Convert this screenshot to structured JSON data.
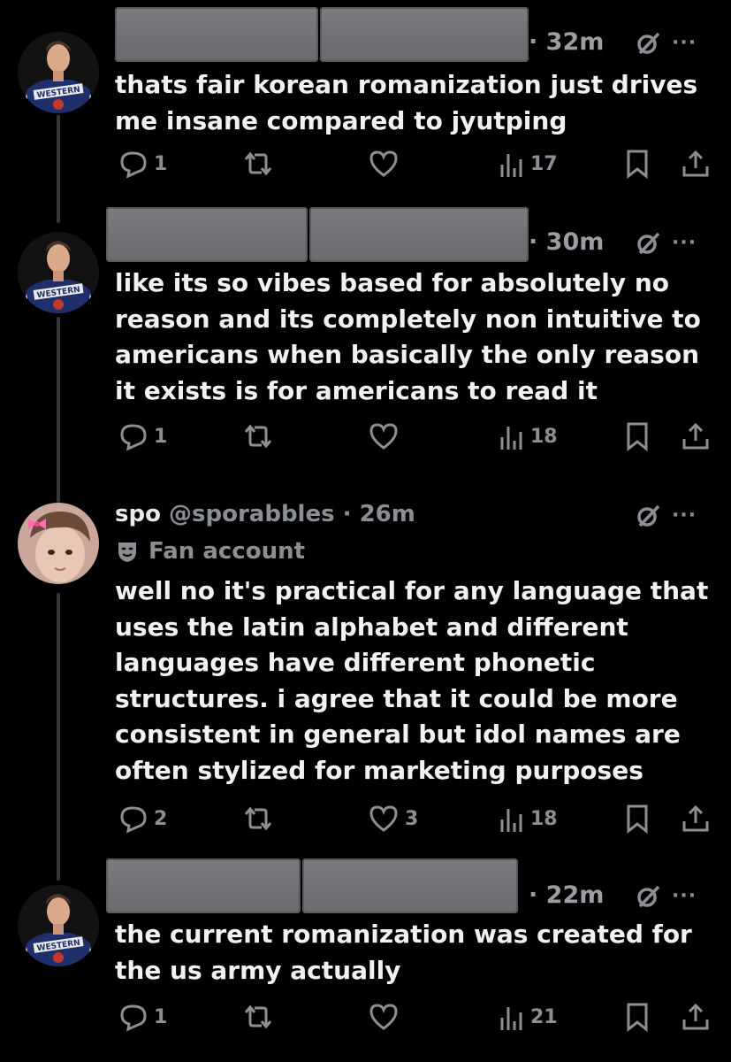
{
  "tweets": [
    {
      "time": "· 32m",
      "text": "thats fair korean romanization just drives\nme insane compared to jyutping",
      "replies": "1",
      "retweets": "",
      "likes": "",
      "views": "17"
    },
    {
      "time": "· 30m",
      "text": "like its so vibes based for absolutely no\nreason and its completely non intuitive to\namericans when basically the only reason\nit exists is for americans to read it",
      "replies": "1",
      "retweets": "",
      "likes": "",
      "views": "18"
    },
    {
      "display_name": "spo",
      "handle": "@sporabbles",
      "time": "· 26m",
      "badge": "Fan account",
      "text": "well no it's practical for any language that\nuses the latin alphabet and different\nlanguages have different phonetic\nstructures. i agree that it could be more\nconsistent in general but idol names are\noften stylized for marketing purposes",
      "replies": "2",
      "retweets": "",
      "likes": "3",
      "views": "18"
    },
    {
      "time": "· 22m",
      "text": "the current romanization was created for\nthe us army actually",
      "replies": "1",
      "retweets": "",
      "likes": "",
      "views": "21"
    }
  ],
  "avatar_jersey_text": "WESTERN",
  "colors": {
    "background": "#000000",
    "text": "#e7e9ea",
    "muted": "#8b8f94",
    "redaction": "#747478"
  }
}
